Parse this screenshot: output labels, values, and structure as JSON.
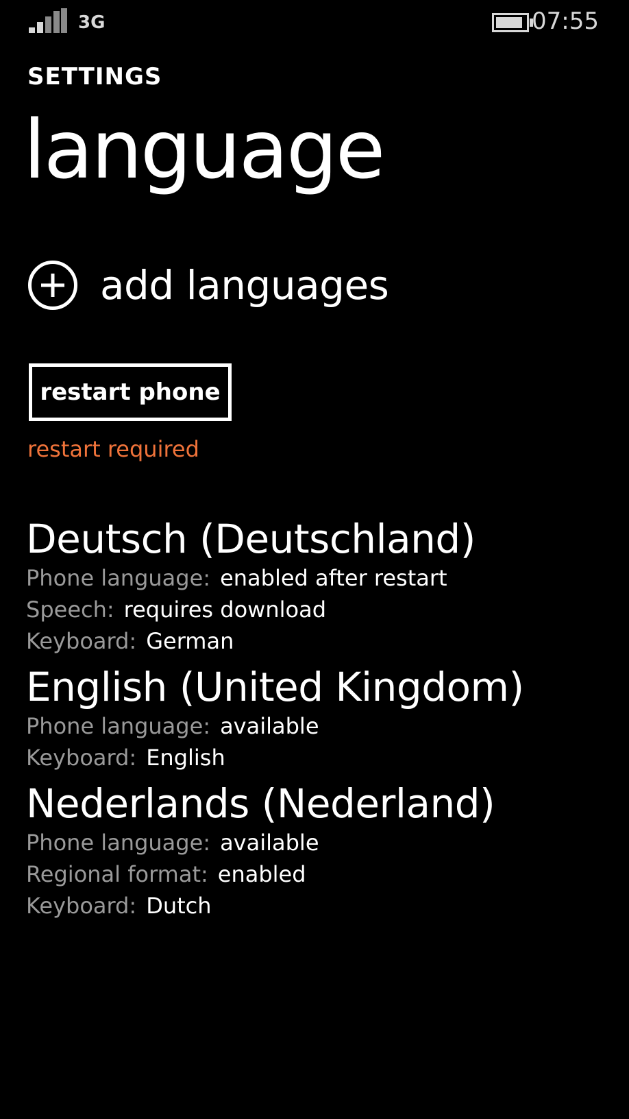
{
  "status_bar": {
    "network": "3G",
    "time": "07:55",
    "signal_bars": 4,
    "battery_level": 0.9,
    "icons": [
      "signal-strength-icon",
      "battery-icon"
    ]
  },
  "header": {
    "section": "SETTINGS",
    "title": "language"
  },
  "add_languages": {
    "label": "add languages",
    "icon": "add-circle-icon"
  },
  "restart": {
    "button_label": "restart phone",
    "note": "restart required",
    "note_color": "#f0733a"
  },
  "colors": {
    "background": "#000000",
    "foreground": "#ffffff",
    "secondary": "#9a9a9a",
    "accent": "#f0733a"
  },
  "languages": [
    {
      "name": "Deutsch (Deutschland)",
      "details": [
        {
          "label": "Phone language:",
          "value": "enabled after restart"
        },
        {
          "label": "Speech:",
          "value": "requires download"
        },
        {
          "label": "Keyboard:",
          "value": "German"
        }
      ]
    },
    {
      "name": "English (United Kingdom)",
      "details": [
        {
          "label": "Phone language:",
          "value": "available"
        },
        {
          "label": "Keyboard:",
          "value": "English"
        }
      ]
    },
    {
      "name": "Nederlands (Nederland)",
      "details": [
        {
          "label": "Phone language:",
          "value": "available"
        },
        {
          "label": "Regional format:",
          "value": "enabled"
        },
        {
          "label": "Keyboard:",
          "value": "Dutch"
        }
      ]
    }
  ]
}
